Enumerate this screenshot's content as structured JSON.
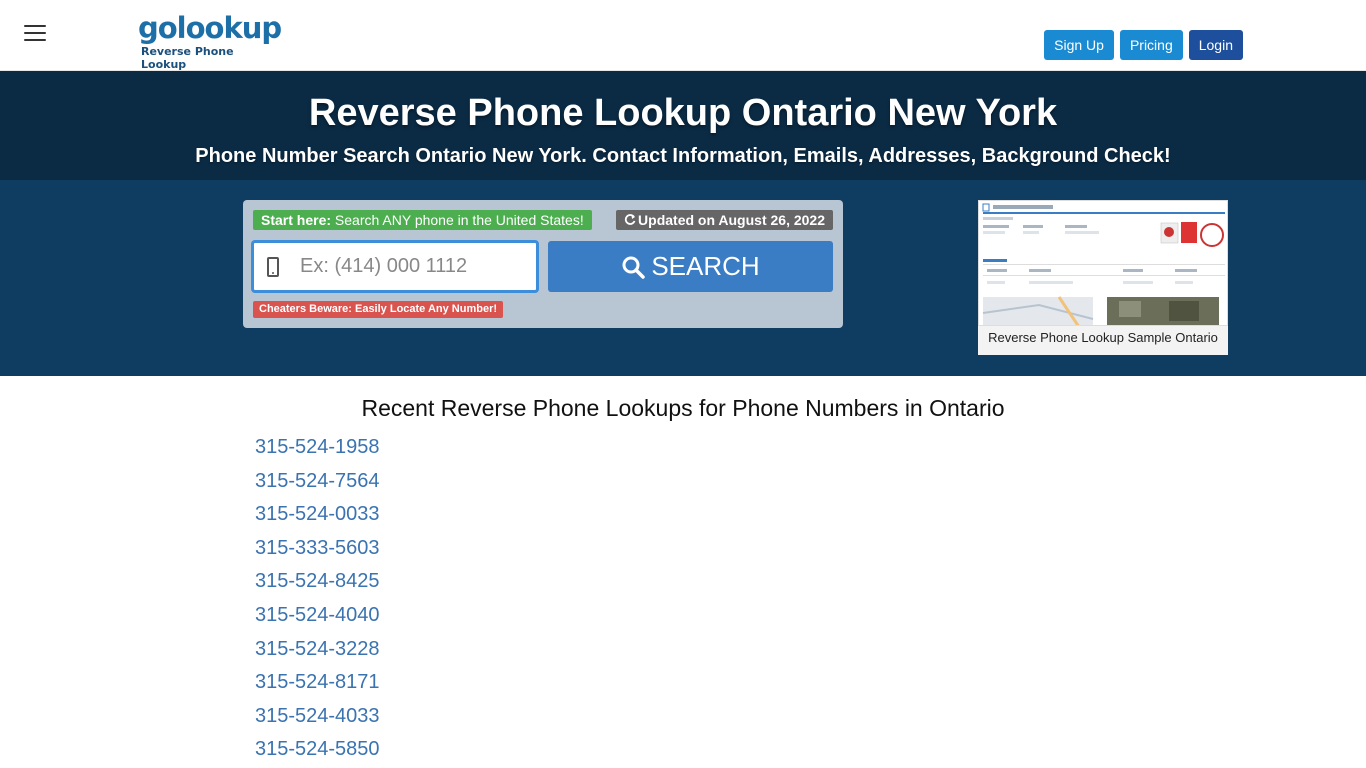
{
  "header": {
    "logo_word": "golookup",
    "logo_sub": "Reverse Phone Lookup",
    "buttons": {
      "signup": "Sign Up",
      "pricing": "Pricing",
      "login": "Login"
    }
  },
  "hero": {
    "title": "Reverse Phone Lookup Ontario New York",
    "subtitle": "Phone Number Search Ontario New York. Contact Information, Emails, Addresses, Background Check!"
  },
  "search": {
    "start_bold": "Start here:",
    "start_text": "Search ANY phone in the United States!",
    "updated": "Updated on August 26, 2022",
    "placeholder": "Ex: (414) 000 1112",
    "button": "SEARCH",
    "cheaters": "Cheaters Beware: Easily Locate Any Number!"
  },
  "sample": {
    "caption": "Reverse Phone Lookup Sample Ontario"
  },
  "recent": {
    "title": "Recent Reverse Phone Lookups for Phone Numbers in Ontario",
    "numbers": [
      "315-524-1958",
      "315-524-7564",
      "315-524-0033",
      "315-333-5603",
      "315-524-8425",
      "315-524-4040",
      "315-524-3228",
      "315-524-8171",
      "315-524-4033",
      "315-524-5850"
    ]
  },
  "colors": {
    "brand_blue": "#1d6fa8",
    "hero_dark": "#0b2b45",
    "hero_mid": "#0f3d62",
    "link_blue": "#3a73b0",
    "success_green": "#4cae4f",
    "danger_red": "#d9534f"
  }
}
